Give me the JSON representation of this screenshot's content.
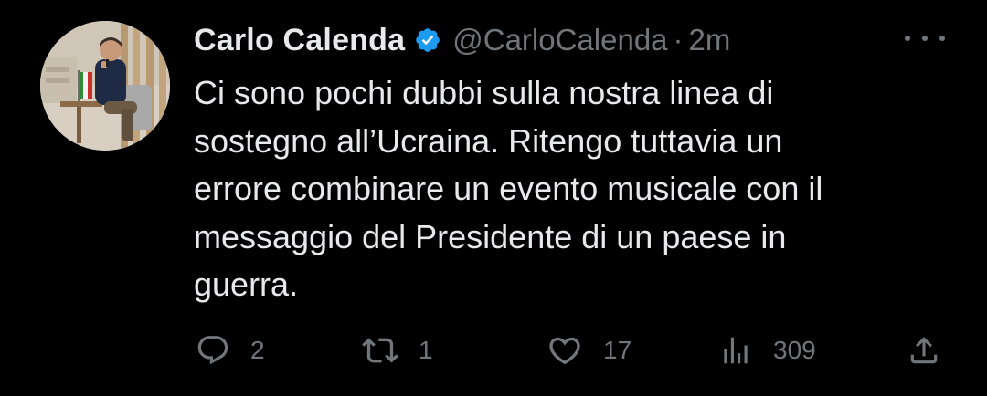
{
  "author": {
    "name": "Carlo Calenda",
    "handle": "@CarloCalenda",
    "separator": "·",
    "timestamp": "2m",
    "verified": true
  },
  "tweet": {
    "text": "Ci sono pochi dubbi sulla nostra linea di\nsostegno all’Ucraina. Ritengo tuttavia un\nerrore combinare un evento musicale con il\nmessaggio del Presidente di un paese in\nguerra."
  },
  "actions": {
    "replies": "2",
    "retweets": "1",
    "likes": "17",
    "views": "309"
  },
  "colors": {
    "background": "#000000",
    "text": "#e7e9ea",
    "secondary": "#71767b",
    "verified_badge": "#1d9bf0"
  },
  "icons": {
    "reply": "speech-bubble-icon",
    "retweet": "retweet-arrows-icon",
    "like": "heart-icon",
    "views": "bar-chart-icon",
    "share": "share-upload-icon",
    "more": "three-dots-icon",
    "verified": "verified-badge-icon"
  }
}
